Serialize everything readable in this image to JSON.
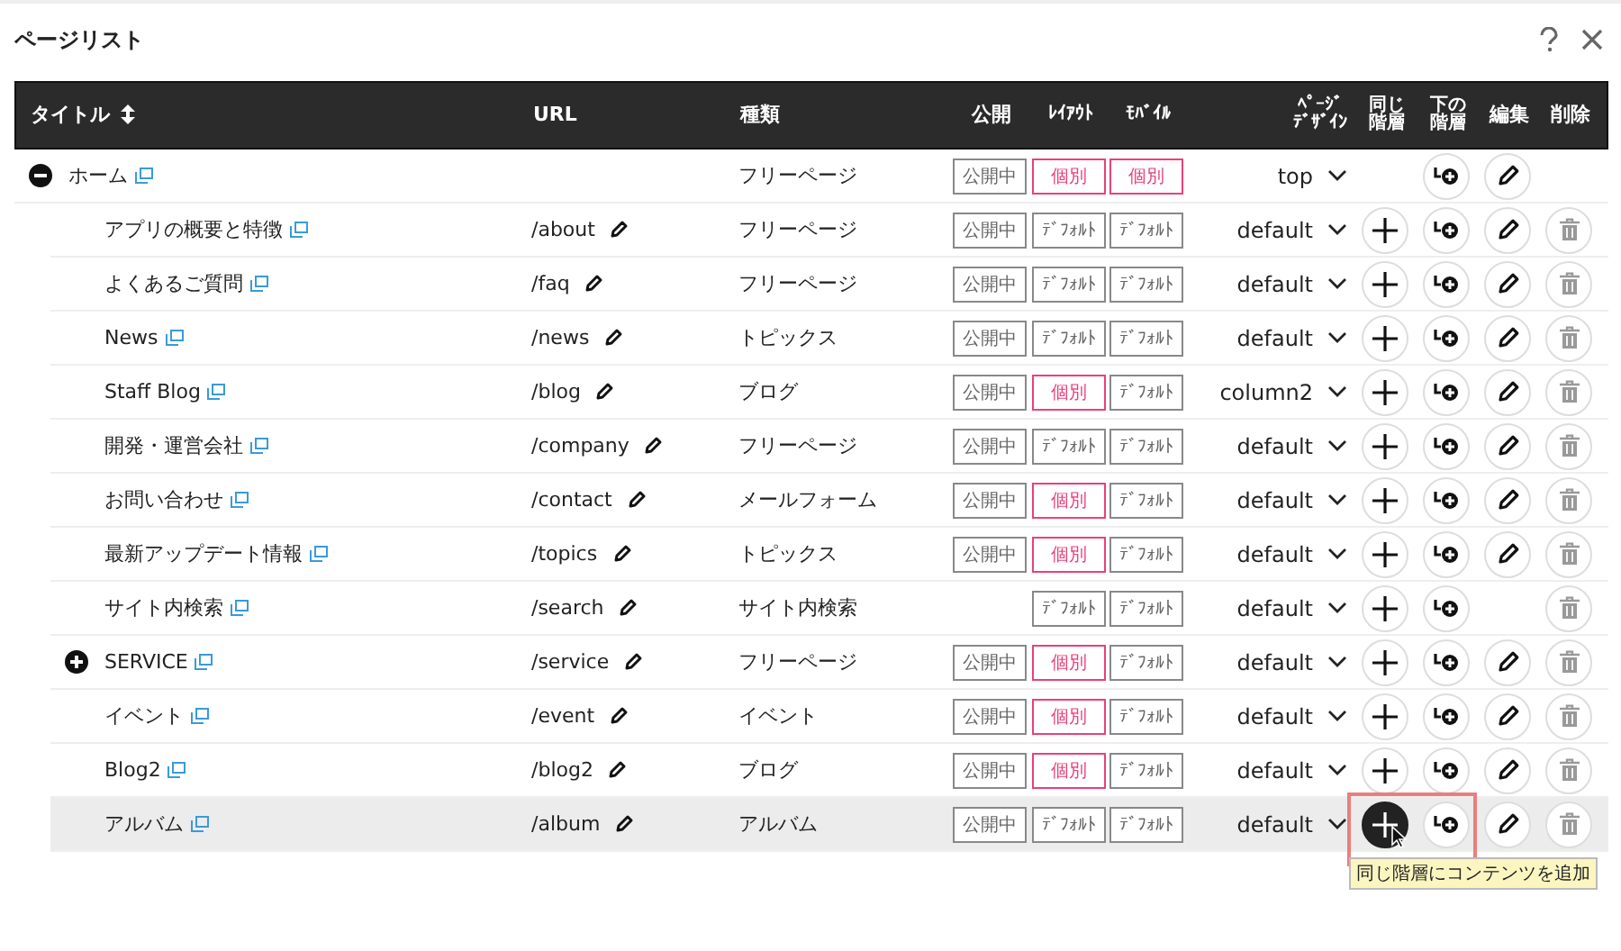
{
  "window": {
    "title": "ページリスト"
  },
  "table": {
    "columns": [
      {
        "label": "タイトル",
        "kind": "title"
      },
      {
        "label": "URL",
        "kind": "url"
      },
      {
        "label": "種類",
        "kind": "type"
      },
      {
        "label": "公開",
        "kind": "public"
      },
      {
        "label": "ﾚｲｱｳﾄ",
        "kind": "layout"
      },
      {
        "label": "ﾓﾊﾞｲﾙ",
        "kind": "mobile"
      },
      {
        "label": "ﾍﾟｰｼﾞﾃﾞｻﾞｲﾝ",
        "kind": "design"
      },
      {
        "label": "同じ階層",
        "kind": "same"
      },
      {
        "label": "下の階層",
        "kind": "child"
      },
      {
        "label": "編集",
        "kind": "edit"
      },
      {
        "label": "削除",
        "kind": "delete"
      }
    ],
    "rows": [
      {
        "title": "ホーム",
        "expanded": true,
        "type": "フリーページ",
        "public": "公開中",
        "layout": {
          "label": "個別",
          "kind": "custom"
        },
        "mobile": {
          "label": "個別",
          "kind": "custom"
        },
        "design": "top",
        "can_add_sibling": false,
        "can_edit": true,
        "can_delete": false,
        "selected": false,
        "children": [
          {
            "title": "アプリの概要と特徴",
            "url": "/about",
            "type": "フリーページ",
            "public": "公開中",
            "layout": {
              "label": "ﾃﾞﾌｫﾙﾄ",
              "kind": "default"
            },
            "mobile": {
              "label": "ﾃﾞﾌｫﾙﾄ",
              "kind": "default"
            },
            "design": "default",
            "can_add_sibling": true,
            "can_edit": true,
            "can_delete": true,
            "selected": false
          },
          {
            "title": "よくあるご質問",
            "url": "/faq",
            "type": "フリーページ",
            "public": "公開中",
            "layout": {
              "label": "ﾃﾞﾌｫﾙﾄ",
              "kind": "default"
            },
            "mobile": {
              "label": "ﾃﾞﾌｫﾙﾄ",
              "kind": "default"
            },
            "design": "default",
            "can_add_sibling": true,
            "can_edit": true,
            "can_delete": true,
            "selected": false
          },
          {
            "title": "News",
            "url": "/news",
            "type": "トピックス",
            "public": "公開中",
            "layout": {
              "label": "ﾃﾞﾌｫﾙﾄ",
              "kind": "default"
            },
            "mobile": {
              "label": "ﾃﾞﾌｫﾙﾄ",
              "kind": "default"
            },
            "design": "default",
            "can_add_sibling": true,
            "can_edit": true,
            "can_delete": true,
            "selected": false
          },
          {
            "title": "Staff Blog",
            "url": "/blog",
            "type": "ブログ",
            "public": "公開中",
            "layout": {
              "label": "個別",
              "kind": "custom"
            },
            "mobile": {
              "label": "ﾃﾞﾌｫﾙﾄ",
              "kind": "default"
            },
            "design": "column2",
            "can_add_sibling": true,
            "can_edit": true,
            "can_delete": true,
            "selected": false
          },
          {
            "title": "開発・運営会社",
            "url": "/company",
            "type": "フリーページ",
            "public": "公開中",
            "layout": {
              "label": "ﾃﾞﾌｫﾙﾄ",
              "kind": "default"
            },
            "mobile": {
              "label": "ﾃﾞﾌｫﾙﾄ",
              "kind": "default"
            },
            "design": "default",
            "can_add_sibling": true,
            "can_edit": true,
            "can_delete": true,
            "selected": false
          },
          {
            "title": "お問い合わせ",
            "url": "/contact",
            "type": "メールフォーム",
            "public": "公開中",
            "layout": {
              "label": "個別",
              "kind": "custom"
            },
            "mobile": {
              "label": "ﾃﾞﾌｫﾙﾄ",
              "kind": "default"
            },
            "design": "default",
            "can_add_sibling": true,
            "can_edit": true,
            "can_delete": true,
            "selected": false
          },
          {
            "title": "最新アップデート情報",
            "url": "/topics",
            "type": "トピックス",
            "public": "公開中",
            "layout": {
              "label": "個別",
              "kind": "custom"
            },
            "mobile": {
              "label": "ﾃﾞﾌｫﾙﾄ",
              "kind": "default"
            },
            "design": "default",
            "can_add_sibling": true,
            "can_edit": true,
            "can_delete": true,
            "selected": false
          },
          {
            "title": "サイト内検索",
            "url": "/search",
            "type": "サイト内検索",
            "layout": {
              "label": "ﾃﾞﾌｫﾙﾄ",
              "kind": "default"
            },
            "mobile": {
              "label": "ﾃﾞﾌｫﾙﾄ",
              "kind": "default"
            },
            "design": "default",
            "can_add_sibling": true,
            "can_edit": false,
            "can_delete": true,
            "selected": false
          },
          {
            "title": "SERVICE",
            "expanded": false,
            "url": "/service",
            "type": "フリーページ",
            "public": "公開中",
            "layout": {
              "label": "個別",
              "kind": "custom"
            },
            "mobile": {
              "label": "ﾃﾞﾌｫﾙﾄ",
              "kind": "default"
            },
            "design": "default",
            "can_add_sibling": true,
            "can_edit": true,
            "can_delete": true,
            "selected": false
          },
          {
            "title": "イベント",
            "url": "/event",
            "type": "イベント",
            "public": "公開中",
            "layout": {
              "label": "個別",
              "kind": "custom"
            },
            "mobile": {
              "label": "ﾃﾞﾌｫﾙﾄ",
              "kind": "default"
            },
            "design": "default",
            "can_add_sibling": true,
            "can_edit": true,
            "can_delete": true,
            "selected": false
          },
          {
            "title": "Blog2",
            "url": "/blog2",
            "type": "ブログ",
            "public": "公開中",
            "layout": {
              "label": "個別",
              "kind": "custom"
            },
            "mobile": {
              "label": "ﾃﾞﾌｫﾙﾄ",
              "kind": "default"
            },
            "design": "default",
            "can_add_sibling": true,
            "can_edit": true,
            "can_delete": true,
            "selected": false
          },
          {
            "title": "アルバム",
            "url": "/album",
            "type": "アルバム",
            "public": "公開中",
            "layout": {
              "label": "ﾃﾞﾌｫﾙﾄ",
              "kind": "default"
            },
            "mobile": {
              "label": "ﾃﾞﾌｫﾙﾄ",
              "kind": "default"
            },
            "design": "default",
            "can_add_sibling": true,
            "can_edit": true,
            "can_delete": true,
            "selected": true,
            "tooltip": "同じ階層にコンテンツを追加"
          }
        ]
      }
    ]
  }
}
